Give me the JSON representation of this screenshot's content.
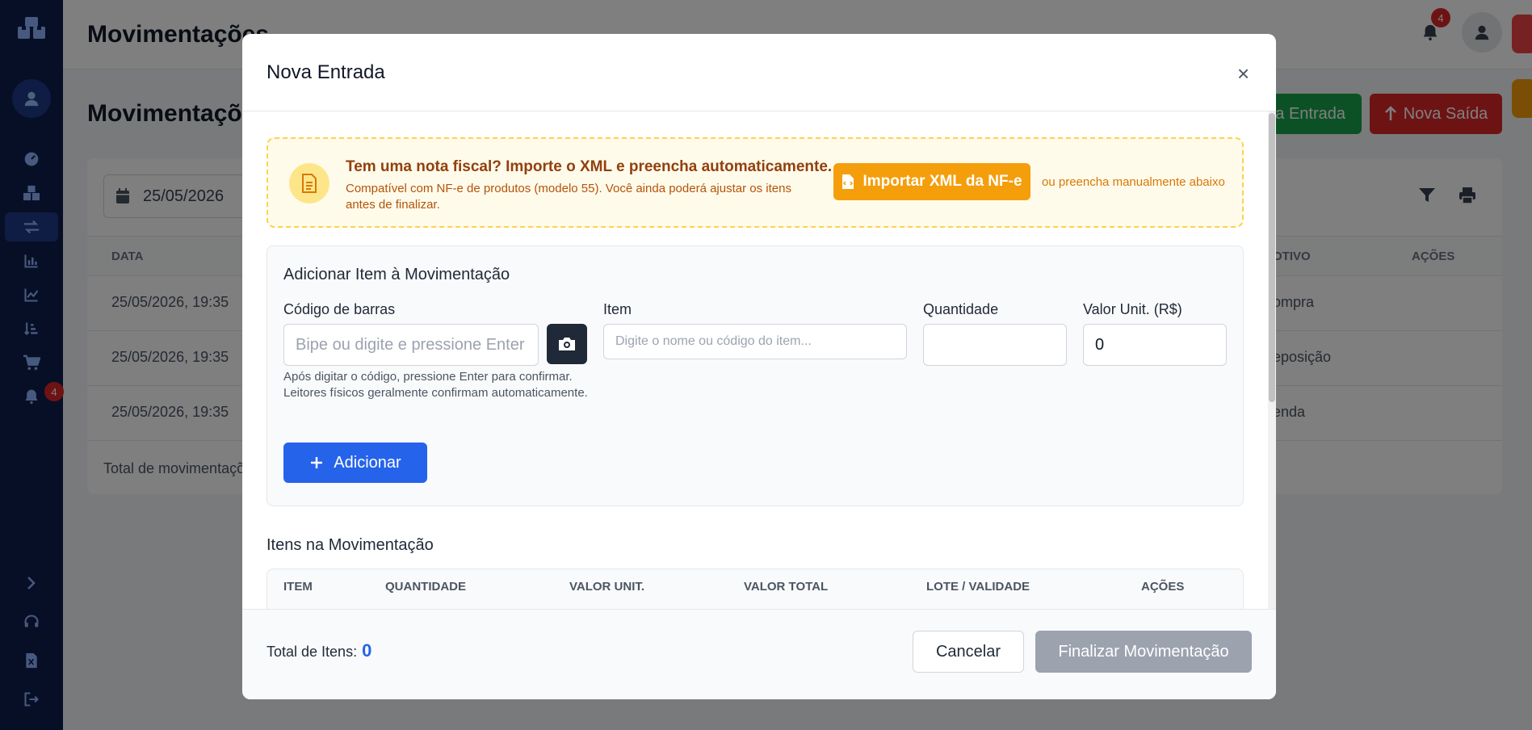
{
  "sidebar": {
    "badge_count": "4",
    "items": [
      {
        "icon": "dashboard-icon"
      },
      {
        "icon": "boxes-icon"
      },
      {
        "icon": "transfer-icon",
        "active": true
      },
      {
        "icon": "bar-chart-icon"
      },
      {
        "icon": "line-chart-icon"
      },
      {
        "icon": "sort-icon"
      },
      {
        "icon": "cart-icon"
      },
      {
        "icon": "bell-icon"
      }
    ]
  },
  "topbar": {
    "title": "Movimentações",
    "notification_count": "4"
  },
  "page": {
    "title": "Movimentações",
    "nova_entrada_label": "a Entrada",
    "nova_saida_label": "Nova Saída",
    "date_filter": "25/05/2026",
    "columns": [
      "DATA",
      "OTIVO",
      "AÇÕES"
    ],
    "rows": [
      {
        "date": "25/05/2026, 19:35",
        "motivo": "ompra"
      },
      {
        "date": "25/05/2026, 19:35",
        "motivo": "eposição"
      },
      {
        "date": "25/05/2026, 19:35",
        "motivo": "enda"
      }
    ],
    "total_label": "Total de movimentaçõ"
  },
  "modal": {
    "title": "Nova Entrada",
    "close_symbol": "×",
    "nfe": {
      "title": "Tem uma nota fiscal? Importe o XML e preencha automaticamente.",
      "description": "Compatível com NF-e de produtos (modelo 55). Você ainda poderá ajustar os itens antes de finalizar.",
      "button": "Importar XML da NF-e",
      "alt_text": "ou preencha manualmente abaixo"
    },
    "add_item": {
      "title": "Adicionar Item à Movimentação",
      "barcode_label": "Código de barras",
      "barcode_placeholder": "Bipe ou digite e pressione Enter",
      "item_label": "Item",
      "item_placeholder": "Digite o nome ou código do item...",
      "qty_label": "Quantidade",
      "qty_value": "",
      "unit_label": "Valor Unit. (R$)",
      "unit_value": "0",
      "hint_line1": "Após digitar o código, pressione Enter para confirmar.",
      "hint_line2": "Leitores físicos geralmente confirmam automaticamente.",
      "add_button": "Adicionar"
    },
    "items": {
      "title": "Itens na Movimentação",
      "columns": [
        "ITEM",
        "QUANTIDADE",
        "VALOR UNIT.",
        "VALOR TOTAL",
        "LOTE / VALIDADE",
        "AÇÕES"
      ]
    },
    "footer": {
      "total_label": "Total de Itens:",
      "total_value": "0",
      "cancel_button": "Cancelar",
      "finalize_button": "Finalizar Movimentação"
    }
  },
  "colors": {
    "sidebar": "#0f1f4d",
    "primary": "#2563eb",
    "warning": "#f59e0b",
    "danger": "#dc2626",
    "success": "#16a34a",
    "disabled": "#9ca3af"
  }
}
